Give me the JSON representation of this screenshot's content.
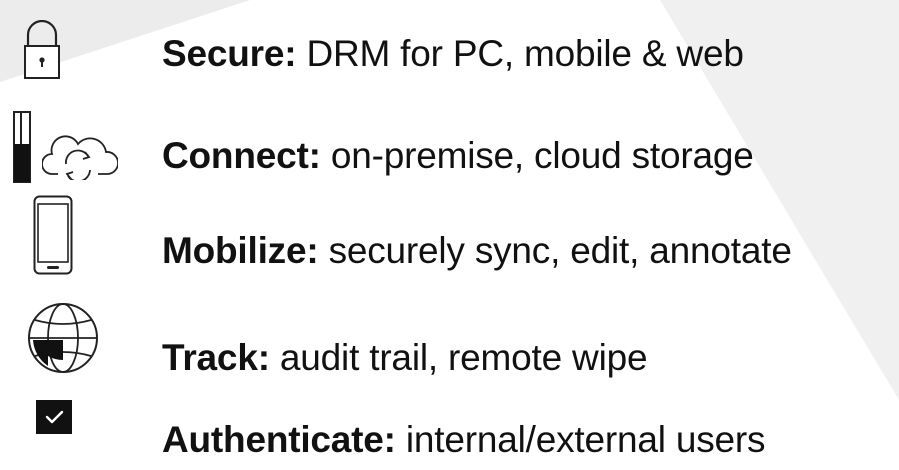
{
  "colors": {
    "text": "#111111",
    "icon_stroke": "#222222",
    "background": "#ffffff",
    "background_wedge": "#efeff0"
  },
  "features": [
    {
      "heading": "Secure:",
      "detail": "DRM for PC, mobile & web",
      "icon": "padlock-icon"
    },
    {
      "heading": "Connect:",
      "detail": "on-premise, cloud storage",
      "icon": "usb-cloud-icon"
    },
    {
      "heading": "Mobilize:",
      "detail": "securely sync, edit, annotate",
      "icon": "smartphone-icon"
    },
    {
      "heading": "Track:",
      "detail": "audit trail, remote wipe",
      "icon": "globe-icon"
    },
    {
      "heading": "Authenticate:",
      "detail": "internal/external users",
      "icon": "checkbox-icon"
    }
  ]
}
